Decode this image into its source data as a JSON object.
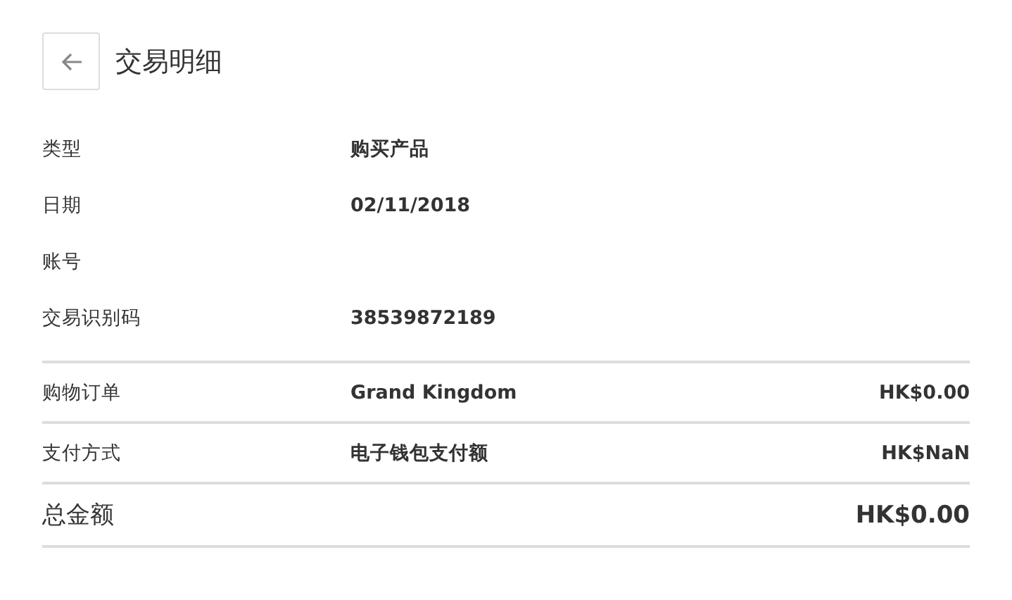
{
  "header": {
    "title": "交易明细"
  },
  "details": [
    {
      "label": "类型",
      "value": "购买产品"
    },
    {
      "label": "日期",
      "value": "02/11/2018"
    },
    {
      "label": "账号"
    },
    {
      "label": "交易识别码",
      "value": "38539872189"
    }
  ],
  "items": [
    {
      "label": "购物订单",
      "value": "Grand Kingdom",
      "amount": "HK$0.00"
    },
    {
      "label": "支付方式",
      "value": "电子钱包支付额",
      "amount": "HK$NaN"
    }
  ],
  "total": {
    "label": "总金额",
    "amount": "HK$0.00"
  }
}
